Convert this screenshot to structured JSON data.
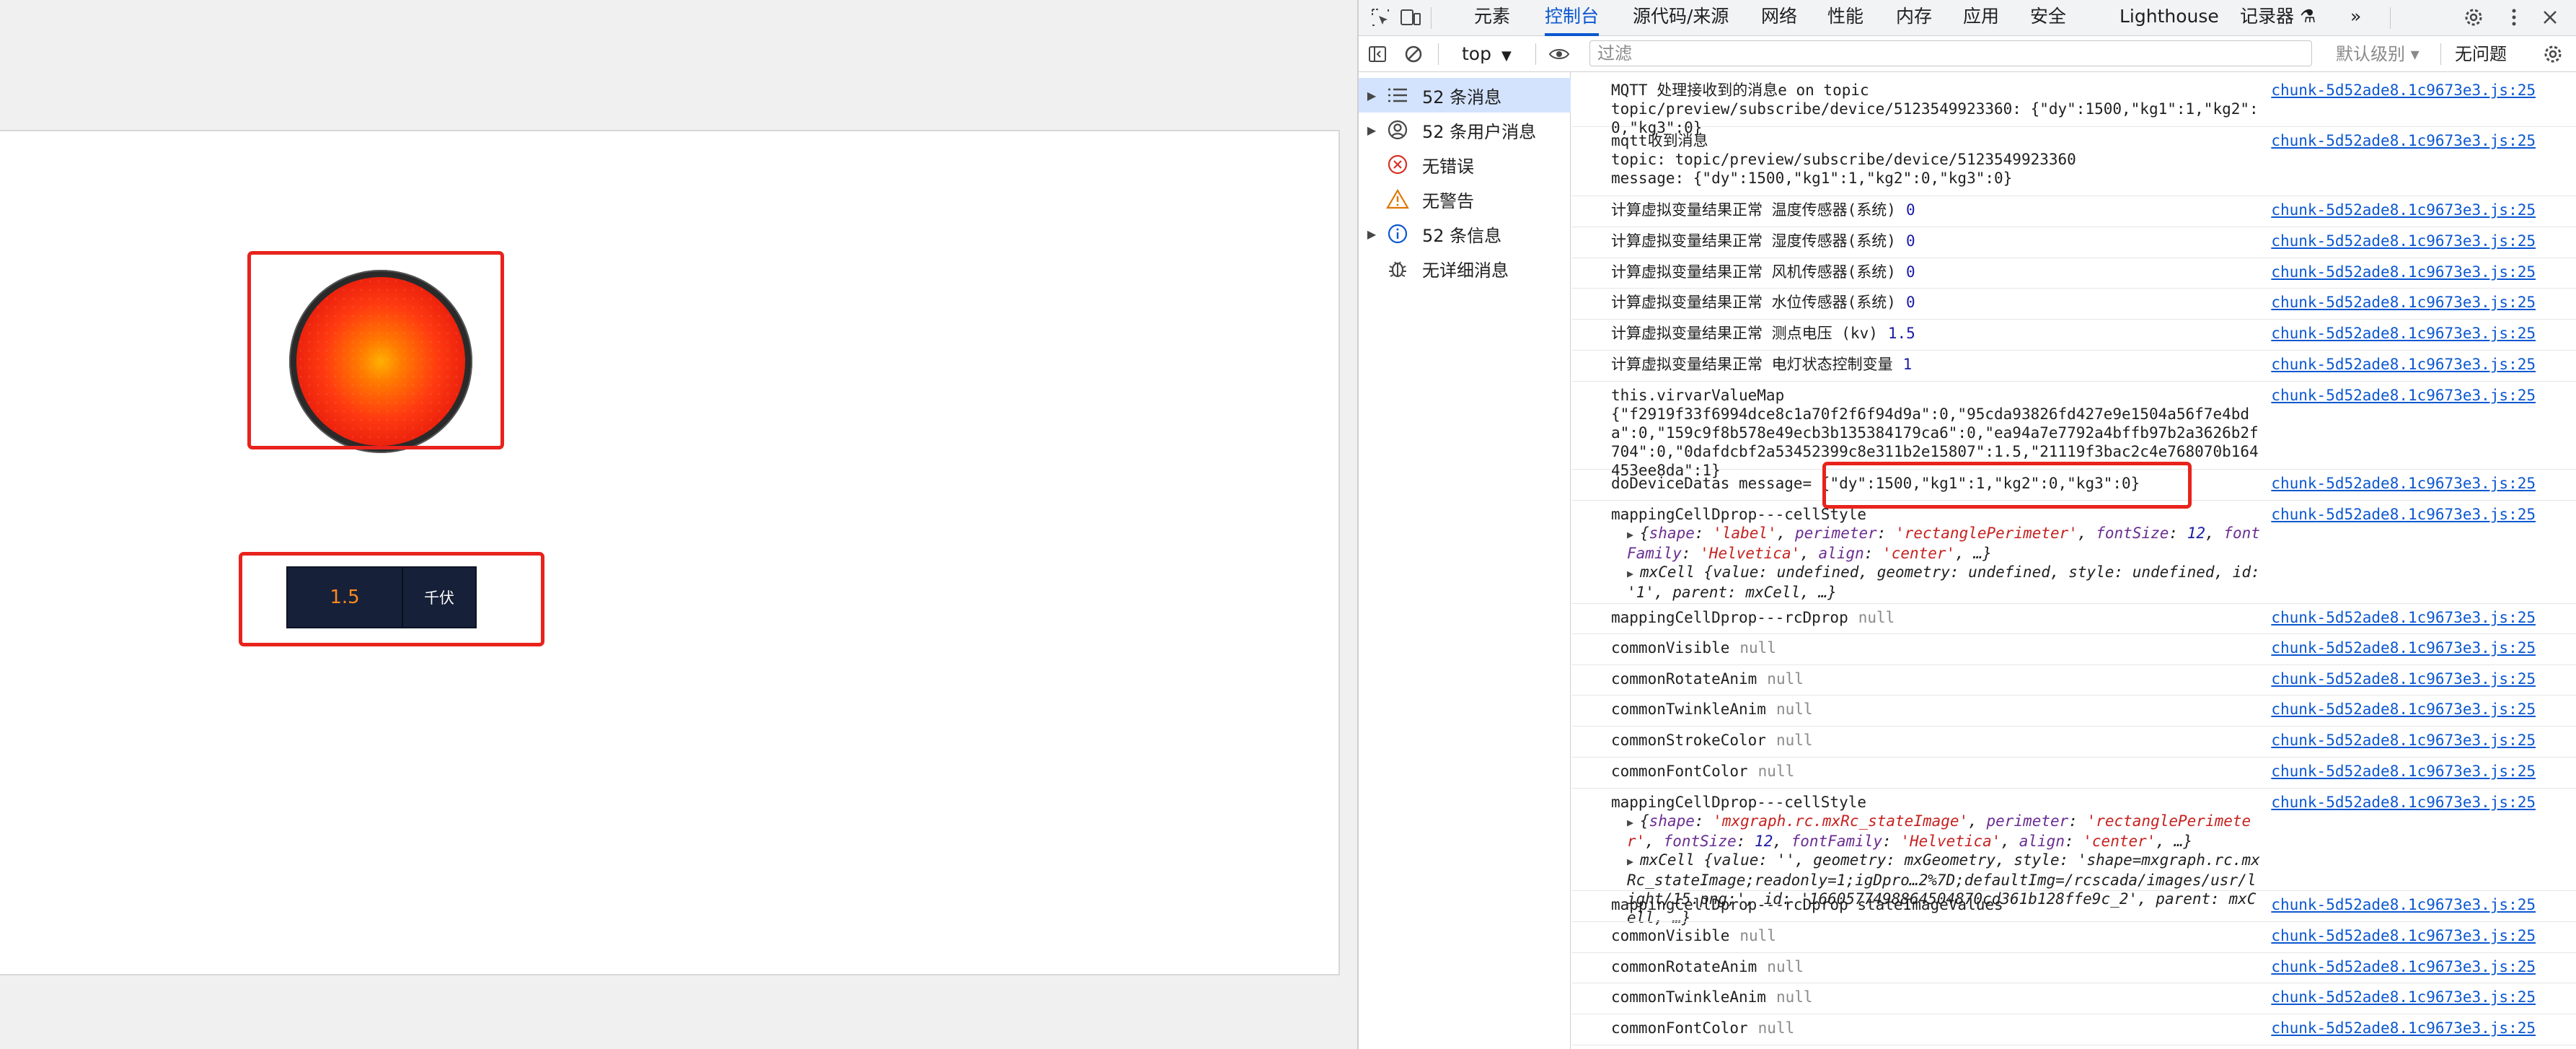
{
  "app": {
    "display": {
      "value": "1.5",
      "unit": "千伏"
    },
    "lamp_state": "on",
    "colors": {
      "highlight": "#e8231c",
      "lamp": "#ff3a10",
      "display_bg": "#172039",
      "display_value": "#ff8a1c"
    }
  },
  "devtools": {
    "tabs": [
      {
        "label": "元素"
      },
      {
        "label": "控制台",
        "active": true
      },
      {
        "label": "源代码/来源"
      },
      {
        "label": "网络"
      },
      {
        "label": "性能"
      },
      {
        "label": "内存"
      },
      {
        "label": "应用"
      },
      {
        "label": "安全"
      },
      {
        "label": "Lighthouse"
      },
      {
        "label": "记录器 ⚗"
      },
      {
        "label": "»"
      }
    ],
    "toolbar": {
      "context": "top",
      "filter_placeholder": "过滤",
      "levels": "默认级别 ▾",
      "issues": "无问题"
    },
    "sidebar": [
      {
        "label": "52 条消息",
        "icon": "list-icon",
        "expandable": true
      },
      {
        "label": "52 条用户消息",
        "icon": "user-icon",
        "expandable": true
      },
      {
        "label": "无错误",
        "icon": "error-icon",
        "expandable": false
      },
      {
        "label": "无警告",
        "icon": "warning-icon",
        "expandable": false
      },
      {
        "label": "52 条信息",
        "icon": "info-icon",
        "expandable": true
      },
      {
        "label": "无详细消息",
        "icon": "bug-icon",
        "expandable": false
      }
    ],
    "console": {
      "source": "chunk-5d52ade8.1c9673e3.js:25",
      "rows": [
        {
          "text": "MQTT 处理接收到的消息e on topic\ntopic/preview/subscribe/device/5123549923360: {\"dy\":1500,\"kg1\":1,\"kg2\":0,\"kg3\":0}"
        },
        {
          "text": "mqtt收到消息\ntopic: topic/preview/subscribe/device/5123549923360\nmessage: {\"dy\":1500,\"kg1\":1,\"kg2\":0,\"kg3\":0}"
        },
        {
          "text": "计算虚拟变量结果正常 温度传感器(系统)",
          "value": "0"
        },
        {
          "text": "计算虚拟变量结果正常 湿度传感器(系统)",
          "value": "0"
        },
        {
          "text": "计算虚拟变量结果正常 风机传感器(系统)",
          "value": "0"
        },
        {
          "text": "计算虚拟变量结果正常 水位传感器(系统)",
          "value": "0"
        },
        {
          "text": "计算虚拟变量结果正常 测点电压 (kv)",
          "value": "1.5"
        },
        {
          "text": "计算虚拟变量结果正常 电灯状态控制变量",
          "value": "1"
        },
        {
          "text": "this.virvarValueMap\n{\"f2919f33f6994dce8c1a70f2f6f94d9a\":0,\"95cda93826fd427e9e1504a56f7e4bda\":0,\"159c9f8b578e49ecb3b135384179ca6\":0,\"ea94a7e7792a4bffb97b2a3626b2f704\":0,\"0dafdcbf2a53452399c8e311b2e15807\":1.5,\"21119f3bac2c4e768070b164453ee8da\":1}"
        },
        {
          "text": "doDeviceDatas message=",
          "extra": " {\"dy\":1500,\"kg1\":1,\"kg2\":0,\"kg3\":0}"
        },
        {
          "text": "mappingCellDprop---cellStyle",
          "obj1": {
            "head": "{",
            "pairs": [
              [
                "shape",
                "'label'"
              ],
              [
                "perimeter",
                "'rectanglePerimeter'"
              ],
              [
                "fontSize",
                "12"
              ],
              [
                "fontFamily",
                "'Helvetica'"
              ],
              [
                "align",
                "'center'"
              ]
            ],
            "tail": ", …}"
          },
          "obj2": "mxCell {value: undefined, geometry: undefined, style: undefined, id: '1', parent: mxCell, …}"
        },
        {
          "text": "mappingCellDprop---rcDprop",
          "value_null": "null"
        },
        {
          "text": "commonVisible",
          "value_null": "null"
        },
        {
          "text": "commonRotateAnim",
          "value_null": "null"
        },
        {
          "text": "commonTwinkleAnim",
          "value_null": "null"
        },
        {
          "text": "commonStrokeColor",
          "value_null": "null"
        },
        {
          "text": "commonFontColor",
          "value_null": "null"
        },
        {
          "text": "mappingCellDprop---cellStyle",
          "obj1": {
            "head": "{",
            "pairs": [
              [
                "shape",
                "'mxgraph.rc.mxRc_stateImage'"
              ],
              [
                "perimeter",
                "'rectanglePerimeter'"
              ],
              [
                "fontSize",
                "12"
              ],
              [
                "fontFamily",
                "'Helvetica'"
              ],
              [
                "align",
                "'center'"
              ]
            ],
            "tail": ", …}"
          },
          "obj2": "mxCell {value: '', geometry: mxGeometry, style: 'shape=mxgraph.rc.mxRc_stateImage;readonly=1;igDpro…2%7D;defaultImg=/rcscada/images/usr/light/15.png;', id: '1660577498864504870cd361b128ffe9c_2', parent: mxCell, …}"
        },
        {
          "text": "mappingCellDprop---rcDprop stateImageValues"
        },
        {
          "text": "commonVisible",
          "value_null": "null"
        },
        {
          "text": "commonRotateAnim",
          "value_null": "null"
        },
        {
          "text": "commonTwinkleAnim",
          "value_null": "null"
        },
        {
          "text": "commonFontColor",
          "value_null": "null"
        }
      ]
    }
  }
}
